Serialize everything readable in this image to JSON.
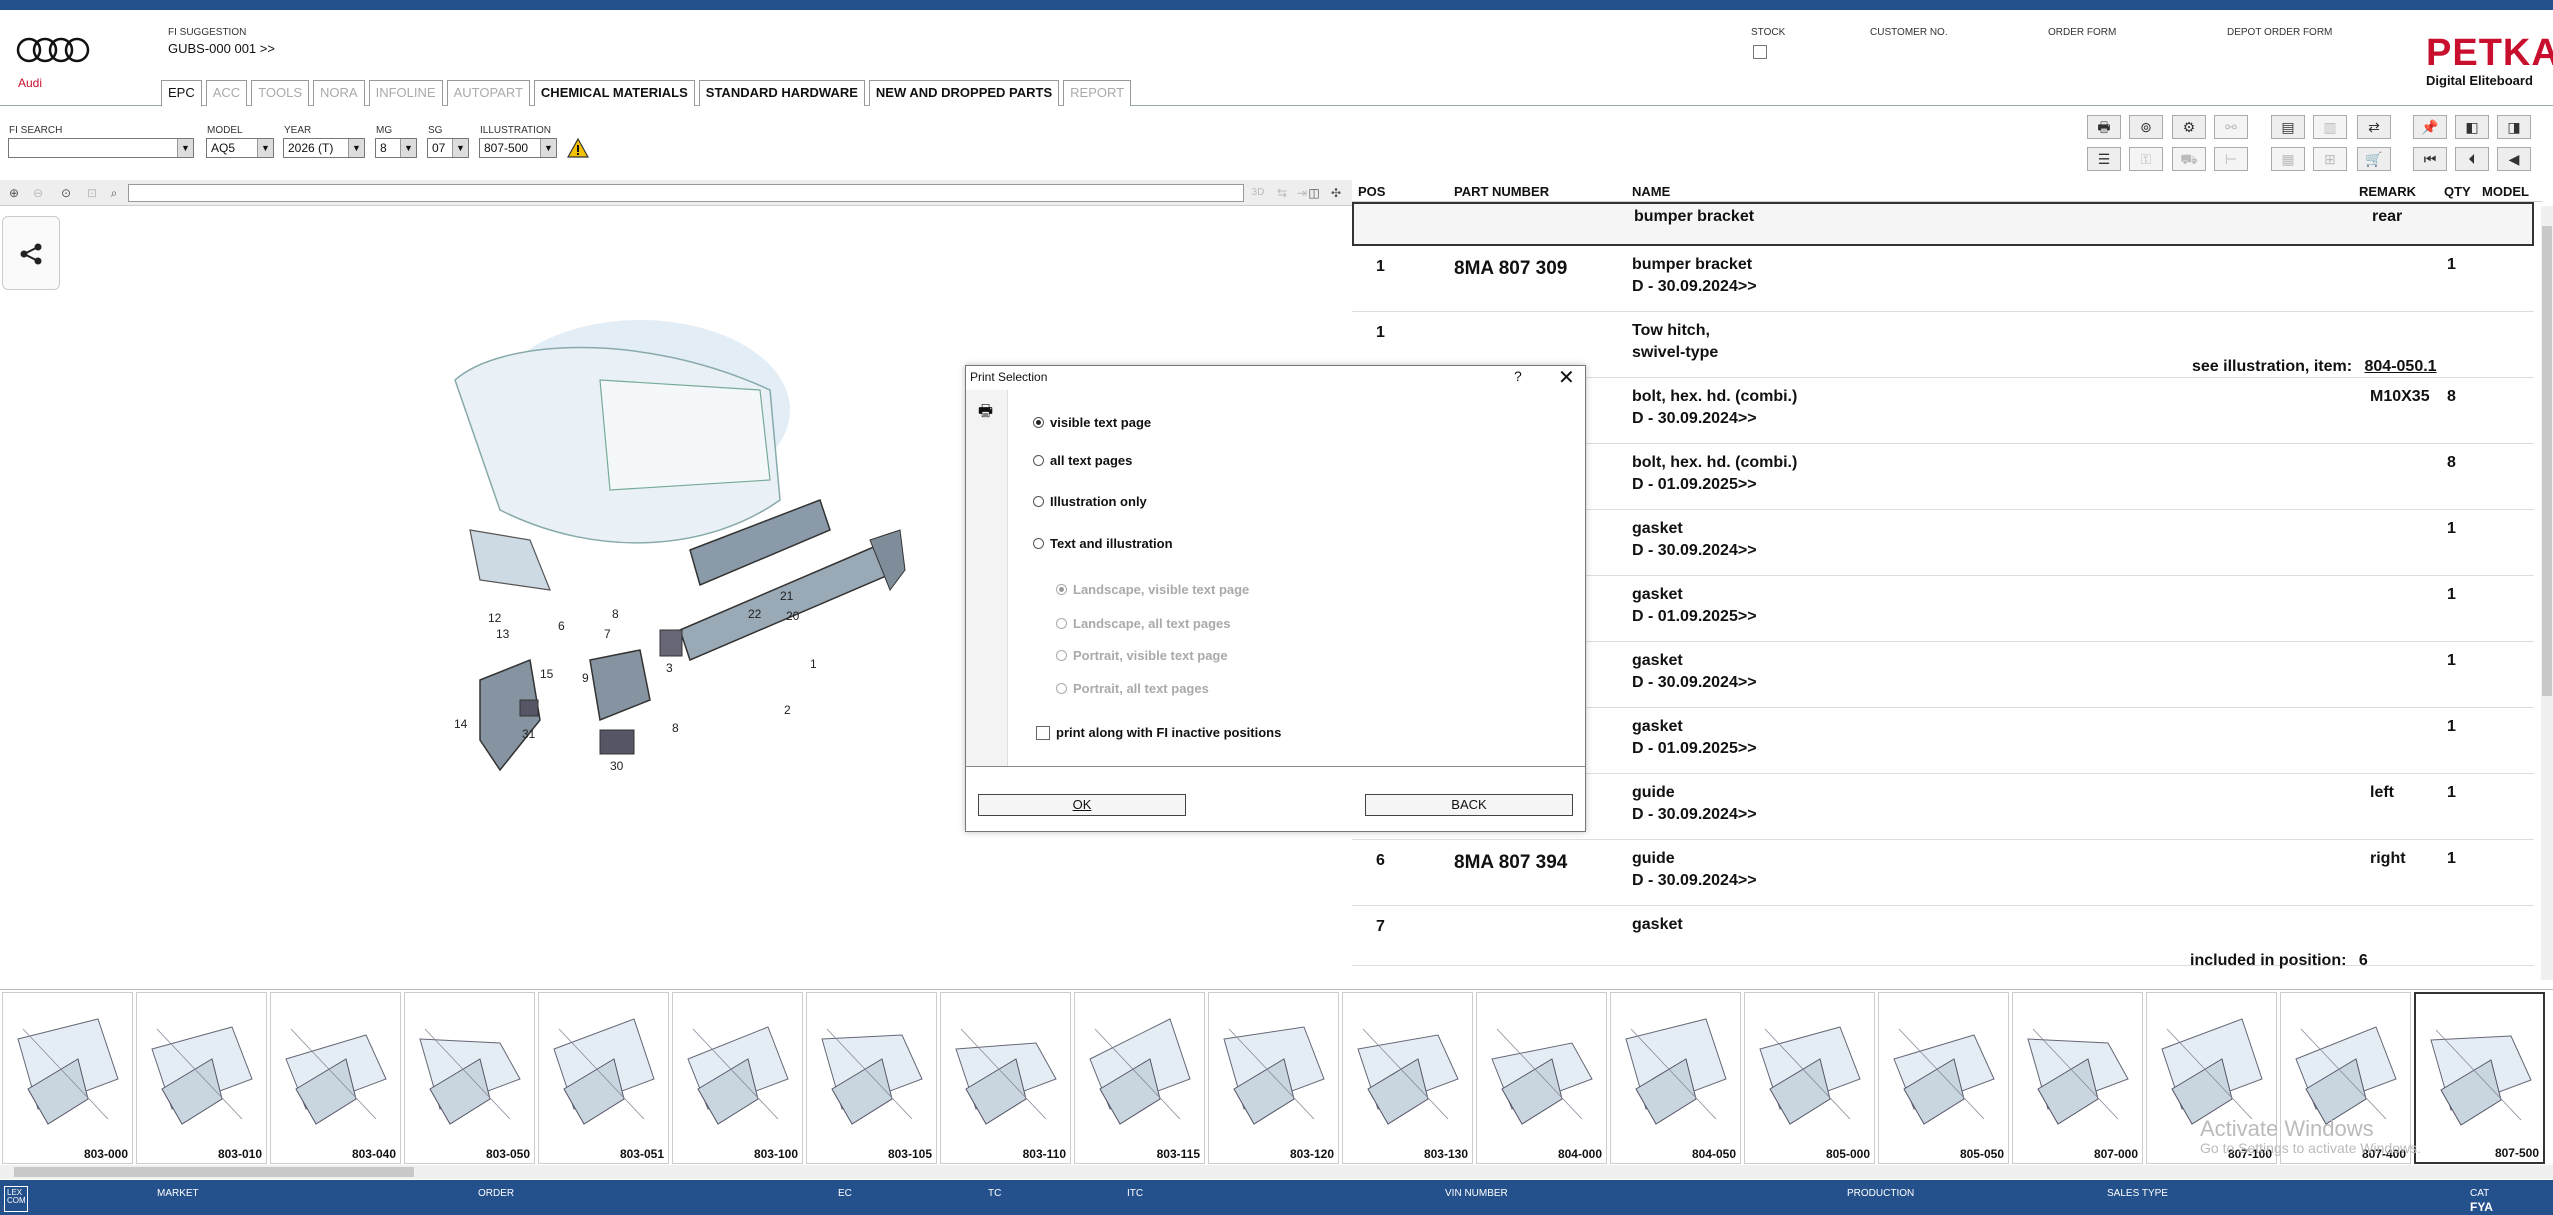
{
  "header": {
    "brand": "Audi",
    "fi_suggestion_label": "FI SUGGESTION",
    "fi_suggestion_value": "GUBS-000 001 >>",
    "stock_label": "STOCK",
    "customer_no_label": "CUSTOMER NO.",
    "order_form_label": "ORDER FORM",
    "depot_order_form_label": "DEPOT ORDER FORM",
    "petka": "PETKA",
    "petka_sub": "Digital Eliteboard"
  },
  "tabs": [
    {
      "label": "EPC"
    },
    {
      "label": "ACC"
    },
    {
      "label": "TOOLS"
    },
    {
      "label": "NORA"
    },
    {
      "label": "INFOLINE"
    },
    {
      "label": "AUTOPART"
    },
    {
      "label": "CHEMICAL MATERIALS"
    },
    {
      "label": "STANDARD HARDWARE"
    },
    {
      "label": "NEW AND DROPPED PARTS"
    },
    {
      "label": "REPORT"
    }
  ],
  "filters": {
    "fi_search_label": "FI SEARCH",
    "fi_search_value": "",
    "model_label": "MODEL",
    "model_value": "AQ5",
    "year_label": "YEAR",
    "year_value": "2026 (T)",
    "mg_label": "MG",
    "mg_value": "8",
    "sg_label": "SG",
    "sg_value": "07",
    "illustration_label": "ILLUSTRATION",
    "illustration_value": "807-500"
  },
  "parts_header": {
    "pos": "POS",
    "part_number": "PART NUMBER",
    "name": "NAME",
    "remark": "REMARK",
    "qty": "QTY",
    "model": "MODEL"
  },
  "parts": [
    {
      "pos": "",
      "pn": "",
      "name1": "bumper bracket",
      "name2": "",
      "remark": "rear",
      "qty": ""
    },
    {
      "pos": "1",
      "pn": "8MA 807 309",
      "name1": "bumper bracket",
      "name2": "D - 30.09.2024>>",
      "remark": "",
      "qty": "1"
    },
    {
      "pos": "1",
      "pn": "",
      "name1": "Tow hitch,",
      "name2": "swivel-type",
      "remark": "",
      "qty": ""
    },
    {
      "pos": "",
      "pn": "",
      "name1": "bolt, hex. hd. (combi.)",
      "name2": "D - 30.09.2024>>",
      "remark": "M10X35",
      "qty": "8"
    },
    {
      "pos": "",
      "pn": "",
      "name1": "bolt, hex. hd. (combi.)",
      "name2": "D - 01.09.2025>>",
      "remark": "",
      "qty": "8"
    },
    {
      "pos": "",
      "pn": "",
      "name1": "gasket",
      "name2": "D - 30.09.2024>>",
      "remark": "",
      "qty": "1"
    },
    {
      "pos": "",
      "pn": "",
      "name1": "gasket",
      "name2": "D - 01.09.2025>>",
      "remark": "",
      "qty": "1"
    },
    {
      "pos": "",
      "pn": "",
      "name1": "gasket",
      "name2": "D - 30.09.2024>>",
      "remark": "",
      "qty": "1"
    },
    {
      "pos": "",
      "pn": "",
      "name1": "gasket",
      "name2": "D - 01.09.2025>>",
      "remark": "",
      "qty": "1"
    },
    {
      "pos": "",
      "pn": "",
      "name1": "guide",
      "name2": "D - 30.09.2024>>",
      "remark": "left",
      "qty": "1"
    },
    {
      "pos": "6",
      "pn": "8MA 807 394",
      "name1": "guide",
      "name2": "D - 30.09.2024>>",
      "remark": "right",
      "qty": "1"
    },
    {
      "pos": "7",
      "pn": "",
      "name1": "gasket",
      "name2": "",
      "remark": "",
      "qty": ""
    }
  ],
  "notes": {
    "see_illustration": "see illustration, item:",
    "see_illustration_ref": "804-050.1",
    "included_in": "included in position:",
    "included_in_ref": "6"
  },
  "illustration_callouts": [
    "12",
    "13",
    "15",
    "9",
    "8",
    "7",
    "3",
    "22",
    "21",
    "20",
    "1",
    "2",
    "8",
    "31",
    "14",
    "30",
    "6"
  ],
  "dialog": {
    "title": "Print Selection",
    "help": "?",
    "close": "✕",
    "options": [
      "visible text page",
      "all text pages",
      "Illustration only",
      "Text and illustration"
    ],
    "sub_options": [
      "Landscape, visible text page",
      "Landscape, all text pages",
      "Portrait, visible text page",
      "Portrait, all text pages"
    ],
    "checkbox_label": "print along with FI inactive positions",
    "ok": "OK",
    "back": "BACK"
  },
  "thumbnails": [
    "803-000",
    "803-010",
    "803-040",
    "803-050",
    "803-051",
    "803-100",
    "803-105",
    "803-110",
    "803-115",
    "803-120",
    "803-130",
    "804-000",
    "804-050",
    "805-000",
    "805-050",
    "807-000",
    "807-100",
    "807-400",
    "807-500"
  ],
  "status": {
    "market": "MARKET",
    "order": "ORDER",
    "ec": "EC",
    "tc": "TC",
    "itc": "ITC",
    "vin": "VIN NUMBER",
    "production": "PRODUCTION",
    "sales_type": "SALES TYPE",
    "cat": "CAT",
    "cat_value": "FYA",
    "lexcom": "LEX COM"
  },
  "watermark": {
    "line1": "Activate Windows",
    "line2": "Go to Settings to activate Windows."
  },
  "colors": {
    "accent": "#24508b",
    "audi_red": "#c8102e"
  }
}
